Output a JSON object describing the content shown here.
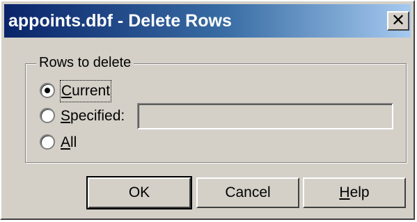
{
  "window": {
    "title": "appoints.dbf - Delete Rows",
    "close_glyph": "✕"
  },
  "group": {
    "legend": "Rows to delete",
    "options": [
      {
        "label_key": "C",
        "label_rest": "urrent",
        "selected": true
      },
      {
        "label_key": "S",
        "label_rest": "pecified:",
        "selected": false
      },
      {
        "label_key": "A",
        "label_rest": "ll",
        "selected": false
      }
    ],
    "specified_value": ""
  },
  "buttons": {
    "ok": "OK",
    "cancel": "Cancel",
    "help_key": "H",
    "help_rest": "elp"
  },
  "colors": {
    "face": "#d4d0c8",
    "title_start": "#0a246a",
    "title_end": "#a6caf0"
  }
}
